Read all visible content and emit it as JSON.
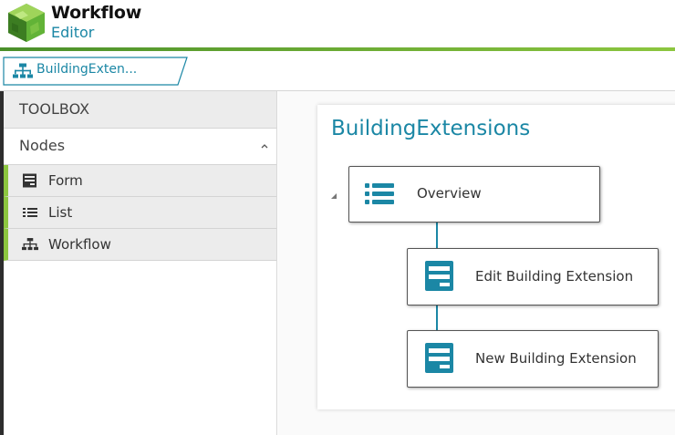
{
  "app": {
    "title": "Workflow",
    "subtitle": "Editor",
    "logo_icon": "green-cube-logo"
  },
  "tabs": [
    {
      "label": "BuildingExten...",
      "icon": "workflow-icon"
    }
  ],
  "toolbox": {
    "title": "TOOLBOX",
    "section": "Nodes",
    "section_expanded": true,
    "items": [
      {
        "label": "Form",
        "icon": "form-icon"
      },
      {
        "label": "List",
        "icon": "list-icon"
      },
      {
        "label": "Workflow",
        "icon": "workflow-icon"
      }
    ]
  },
  "workflow": {
    "title": "BuildingExtensions",
    "nodes": [
      {
        "label": "Overview",
        "icon": "list-icon"
      },
      {
        "label": "Edit Building Extension",
        "icon": "form-icon"
      },
      {
        "label": "New Building Extension",
        "icon": "form-icon"
      }
    ]
  },
  "colors": {
    "accent": "#1b87a5",
    "brand_green": "#8cc63f",
    "brand_green_dark": "#4a8f2a"
  }
}
